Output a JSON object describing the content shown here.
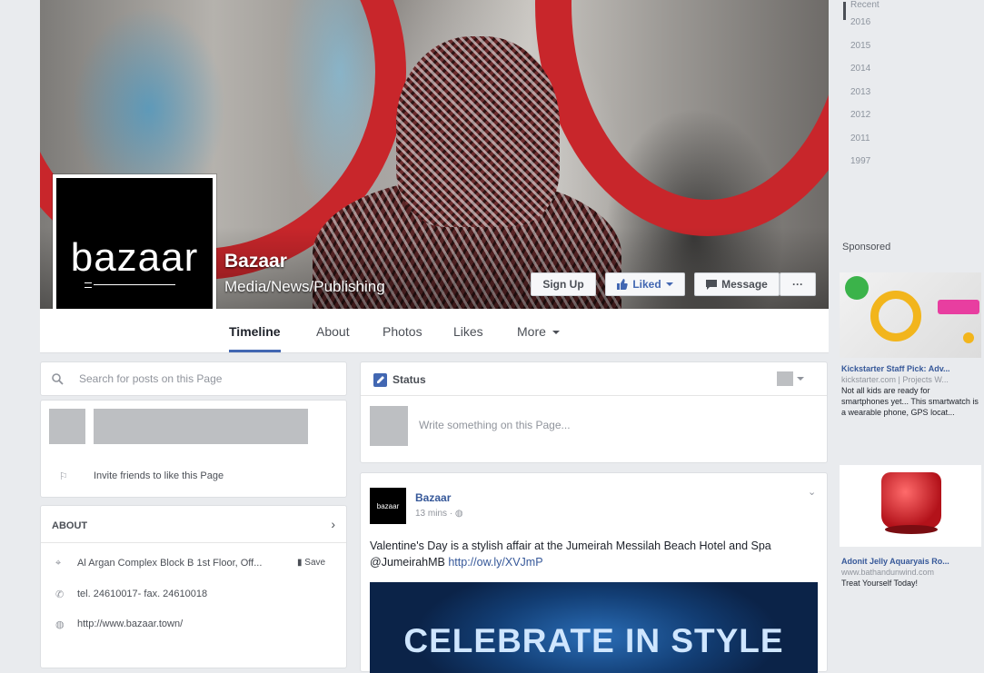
{
  "colors": {
    "accent": "#4267b2",
    "link": "#365899",
    "background": "#e9ebee",
    "cover_red": "#c8262b"
  },
  "page": {
    "name": "Bazaar",
    "category": "Media/News/Publishing",
    "logo_text": "bazaar"
  },
  "cover_buttons": {
    "sign_up": "Sign Up",
    "liked": "Liked",
    "message": "Message",
    "more": "···"
  },
  "nav": {
    "tabs": [
      {
        "label": "Timeline",
        "active": true
      },
      {
        "label": "About"
      },
      {
        "label": "Photos"
      },
      {
        "label": "Likes"
      },
      {
        "label": "More"
      }
    ]
  },
  "left": {
    "search_placeholder": "Search for posts on this Page",
    "invite_text": "Invite friends to like this Page",
    "about_header": "ABOUT",
    "address": "Al Argan Complex Block B 1st Floor, Off...",
    "save_label": "Save",
    "phone": "tel. 24610017- fax. 24610018",
    "website": "http://www.bazaar.town/"
  },
  "composer": {
    "status_label": "Status",
    "placeholder": "Write something on this Page..."
  },
  "post": {
    "author": "Bazaar",
    "time": "13 mins",
    "text": "Valentine's Day is a stylish affair at the Jumeirah Messilah Beach Hotel and Spa @JumeirahMB",
    "link": "http://ow.ly/XVJmP",
    "image_caption": "CELEBRATE IN STYLE",
    "avatar_text": "bazaar"
  },
  "sidebar": {
    "years": [
      "Recent",
      "2016",
      "2015",
      "2014",
      "2013",
      "2012",
      "2011",
      "1997"
    ],
    "sponsored_label": "Sponsored",
    "ads": [
      {
        "title": "Kickstarter Staff Pick: Adv...",
        "url": "kickstarter.com | Projects W...",
        "text": "Not all kids are ready for smartphones yet... This smartwatch is a wearable phone, GPS locat..."
      },
      {
        "title": "Adonit Jelly Aquaryais Ro...",
        "url": "www.bathandunwind.com",
        "text": "Treat Yourself Today!"
      }
    ]
  }
}
